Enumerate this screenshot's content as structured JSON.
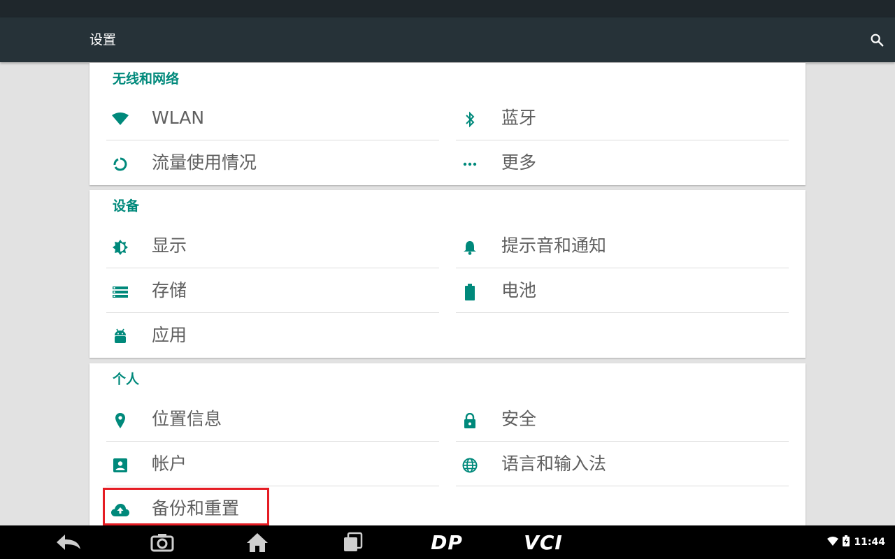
{
  "app_bar": {
    "title": "设置",
    "search_icon": "search-icon"
  },
  "colors": {
    "accent": "#00897b",
    "appbar": "#263238",
    "text": "#5f5f5f",
    "highlight": "#e51c23"
  },
  "sections": [
    {
      "header": "无线和网络",
      "items": [
        {
          "label": "WLAN",
          "icon": "wifi-icon"
        },
        {
          "label": "蓝牙",
          "icon": "bluetooth-icon"
        },
        {
          "label": "流量使用情况",
          "icon": "data-usage-icon"
        },
        {
          "label": "更多",
          "icon": "more-icon"
        }
      ]
    },
    {
      "header": "设备",
      "items": [
        {
          "label": "显示",
          "icon": "brightness-icon"
        },
        {
          "label": "提示音和通知",
          "icon": "bell-icon"
        },
        {
          "label": "存储",
          "icon": "storage-icon"
        },
        {
          "label": "电池",
          "icon": "battery-icon"
        },
        {
          "label": "应用",
          "icon": "android-icon"
        }
      ]
    },
    {
      "header": "个人",
      "items": [
        {
          "label": "位置信息",
          "icon": "location-icon"
        },
        {
          "label": "安全",
          "icon": "lock-icon"
        },
        {
          "label": "帐户",
          "icon": "account-icon"
        },
        {
          "label": "语言和输入法",
          "icon": "globe-icon"
        },
        {
          "label": "备份和重置",
          "icon": "cloud-upload-icon"
        }
      ]
    }
  ],
  "nav_bar": {
    "brand_left": "DP",
    "brand_right": "VCI",
    "clock": "11:44"
  }
}
